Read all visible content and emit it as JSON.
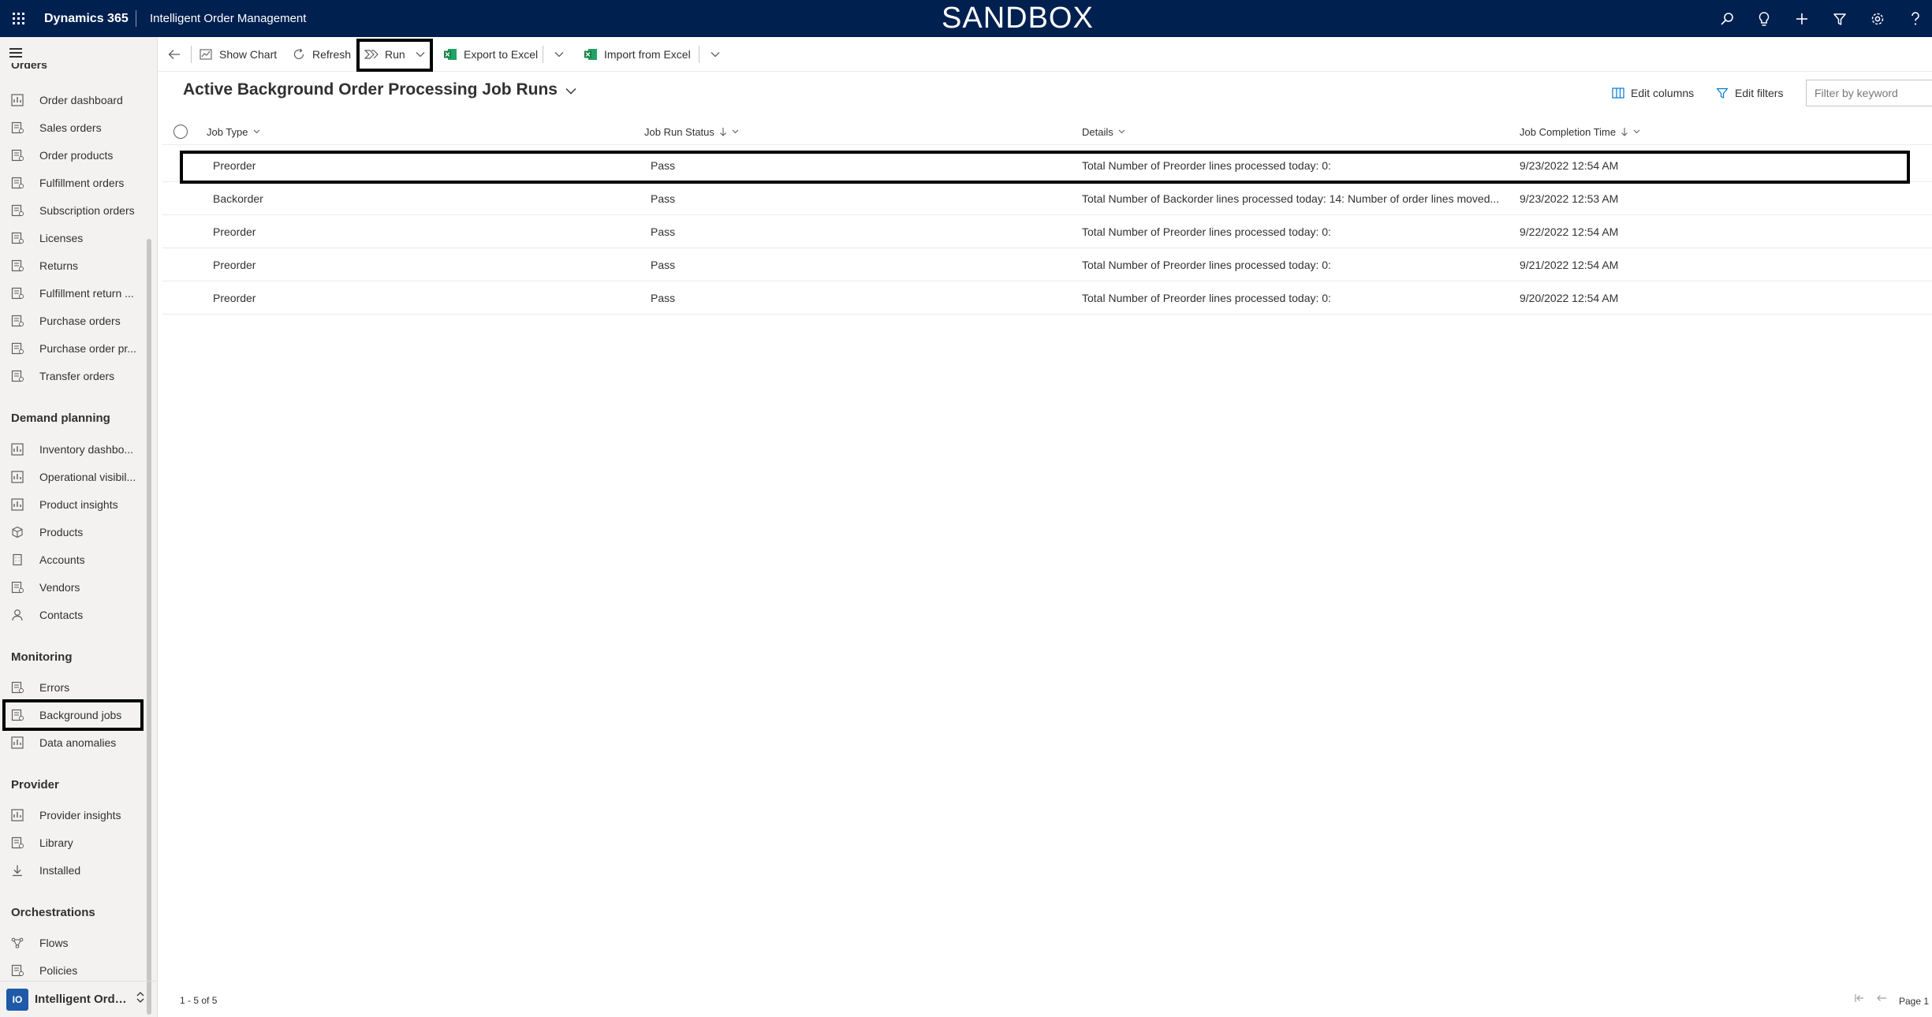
{
  "topbar": {
    "brand": "Dynamics 365",
    "app_name": "Intelligent Order Management",
    "environment_banner": "SANDBOX",
    "icons": [
      "search-icon",
      "lightbulb-icon",
      "plus-icon",
      "filter-icon",
      "gear-icon",
      "help-icon"
    ]
  },
  "sidebar": {
    "cut_group": "Orders",
    "orders_items": [
      {
        "label": "Order dashboard",
        "icon": "dashboard-icon"
      },
      {
        "label": "Sales orders",
        "icon": "list-icon"
      },
      {
        "label": "Order products",
        "icon": "list-icon"
      },
      {
        "label": "Fulfillment orders",
        "icon": "list-icon"
      },
      {
        "label": "Subscription orders",
        "icon": "list-icon"
      },
      {
        "label": "Licenses",
        "icon": "list-icon"
      },
      {
        "label": "Returns",
        "icon": "list-icon"
      },
      {
        "label": "Fulfillment return ...",
        "icon": "list-icon"
      },
      {
        "label": "Purchase orders",
        "icon": "list-icon"
      },
      {
        "label": "Purchase order pr...",
        "icon": "list-icon"
      },
      {
        "label": "Transfer orders",
        "icon": "list-icon"
      }
    ],
    "demand_planning_title": "Demand planning",
    "demand_planning_items": [
      {
        "label": "Inventory dashbo...",
        "icon": "dashboard-icon"
      },
      {
        "label": "Operational visibil...",
        "icon": "dashboard-icon"
      },
      {
        "label": "Product insights",
        "icon": "dashboard-icon"
      },
      {
        "label": "Products",
        "icon": "cube-icon"
      },
      {
        "label": "Accounts",
        "icon": "building-icon"
      },
      {
        "label": "Vendors",
        "icon": "list-icon"
      },
      {
        "label": "Contacts",
        "icon": "person-icon"
      }
    ],
    "monitoring_title": "Monitoring",
    "monitoring_items": [
      {
        "label": "Errors",
        "icon": "list-icon"
      },
      {
        "label": "Background jobs",
        "icon": "list-icon"
      },
      {
        "label": "Data anomalies",
        "icon": "dashboard-icon"
      }
    ],
    "provider_title": "Provider",
    "provider_items": [
      {
        "label": "Provider insights",
        "icon": "dashboard-icon"
      },
      {
        "label": "Library",
        "icon": "list-icon"
      },
      {
        "label": "Installed",
        "icon": "download-icon"
      }
    ],
    "orchestrations_title": "Orchestrations",
    "orchestrations_items": [
      {
        "label": "Flows",
        "icon": "flow-icon"
      },
      {
        "label": "Policies",
        "icon": "list-icon"
      }
    ],
    "area": {
      "badge": "IO",
      "name": "Intelligent Order ..."
    }
  },
  "commandbar": {
    "show_chart": "Show Chart",
    "refresh": "Refresh",
    "run": "Run",
    "export_excel": "Export to Excel",
    "import_excel": "Import from Excel"
  },
  "view": {
    "title": "Active Background Order Processing Job Runs",
    "edit_columns": "Edit columns",
    "edit_filters": "Edit filters",
    "filter_placeholder": "Filter by keyword"
  },
  "grid": {
    "columns": [
      "Job Type",
      "Job Run Status",
      "Details",
      "Job Completion Time"
    ],
    "rows": [
      {
        "job_type": "Preorder",
        "status": "Pass",
        "details": "Total Number of Preorder lines processed today: 0:",
        "time": "9/23/2022 12:54 AM"
      },
      {
        "job_type": "Backorder",
        "status": "Pass",
        "details": "Total Number of Backorder lines processed today: 14: Number of order lines moved...",
        "time": "9/23/2022 12:53 AM"
      },
      {
        "job_type": "Preorder",
        "status": "Pass",
        "details": "Total Number of Preorder lines processed today: 0:",
        "time": "9/22/2022 12:54 AM"
      },
      {
        "job_type": "Preorder",
        "status": "Pass",
        "details": "Total Number of Preorder lines processed today: 0:",
        "time": "9/21/2022 12:54 AM"
      },
      {
        "job_type": "Preorder",
        "status": "Pass",
        "details": "Total Number of Preorder lines processed today: 0:",
        "time": "9/20/2022 12:54 AM"
      }
    ]
  },
  "footer": {
    "count": "1 - 5 of 5",
    "page": "Page 1"
  },
  "colors": {
    "topbar_bg": "#002050",
    "sidebar_bg": "#f3f2f1",
    "excel_green": "#107c41",
    "area_badge": "#1e5aa8"
  }
}
